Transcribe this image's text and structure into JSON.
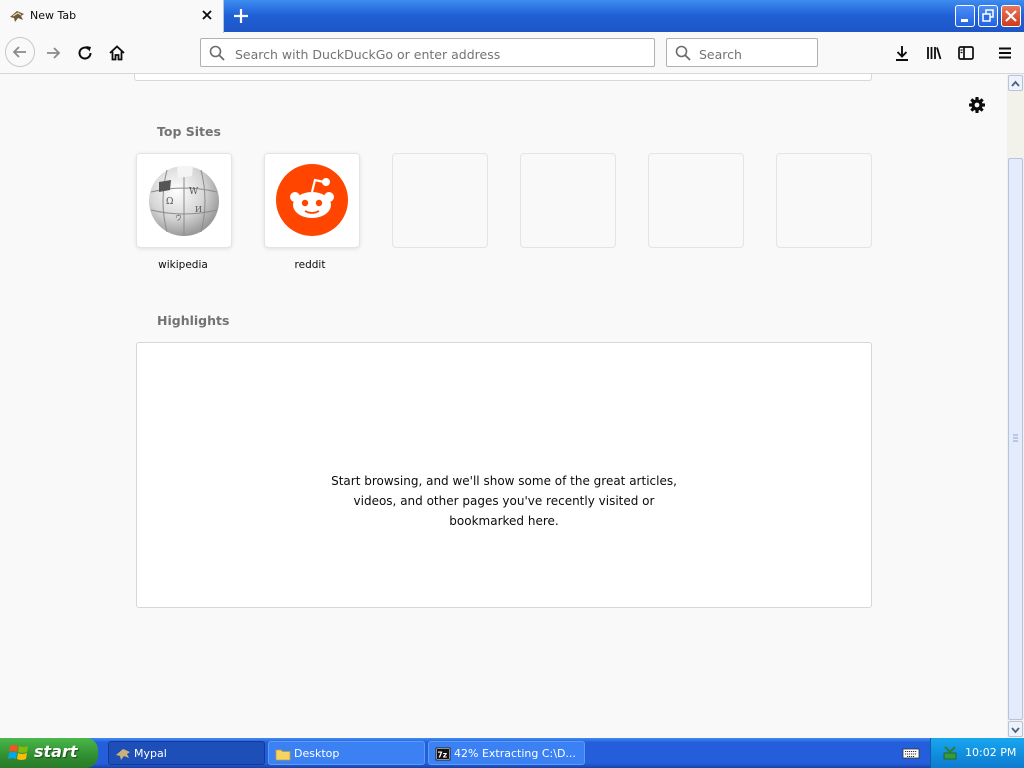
{
  "browser": {
    "tab": {
      "title": "New Tab",
      "favicon": "mypal-icon"
    },
    "new_tab_icon": "plus-icon",
    "window_buttons": [
      "minimize-icon",
      "restore-icon",
      "close-icon"
    ]
  },
  "navbar": {
    "url_placeholder": "Search with DuckDuckGo or enter address",
    "search_placeholder": "Search",
    "icons": [
      "back-icon",
      "forward-icon",
      "reload-icon",
      "home-icon",
      "download-icon",
      "library-icon",
      "sidebar-icon",
      "menu-icon"
    ]
  },
  "content": {
    "top_sites_title": "Top Sites",
    "top_sites": [
      {
        "label": "wikipedia",
        "icon": "wikipedia-globe-icon"
      },
      {
        "label": "reddit",
        "icon": "reddit-icon"
      },
      {
        "label": ""
      },
      {
        "label": ""
      },
      {
        "label": ""
      },
      {
        "label": ""
      }
    ],
    "highlights_title": "Highlights",
    "highlights_message": [
      "Start browsing, and we'll show some of the great articles,",
      "videos, and other pages you've recently visited or",
      "bookmarked here."
    ]
  },
  "taskbar": {
    "start_label": "start",
    "tasks": [
      {
        "label": "Mypal",
        "active": true
      },
      {
        "label": "Desktop",
        "active": false
      },
      {
        "label": "42% Extracting C:\\D...",
        "active": false
      }
    ],
    "clock": "10:02 PM"
  },
  "colors": {
    "titlebar_blue": "#245edb",
    "reddit_orange": "#ff4500",
    "start_green": "#308e30",
    "page_bg": "#f9f9fa"
  }
}
